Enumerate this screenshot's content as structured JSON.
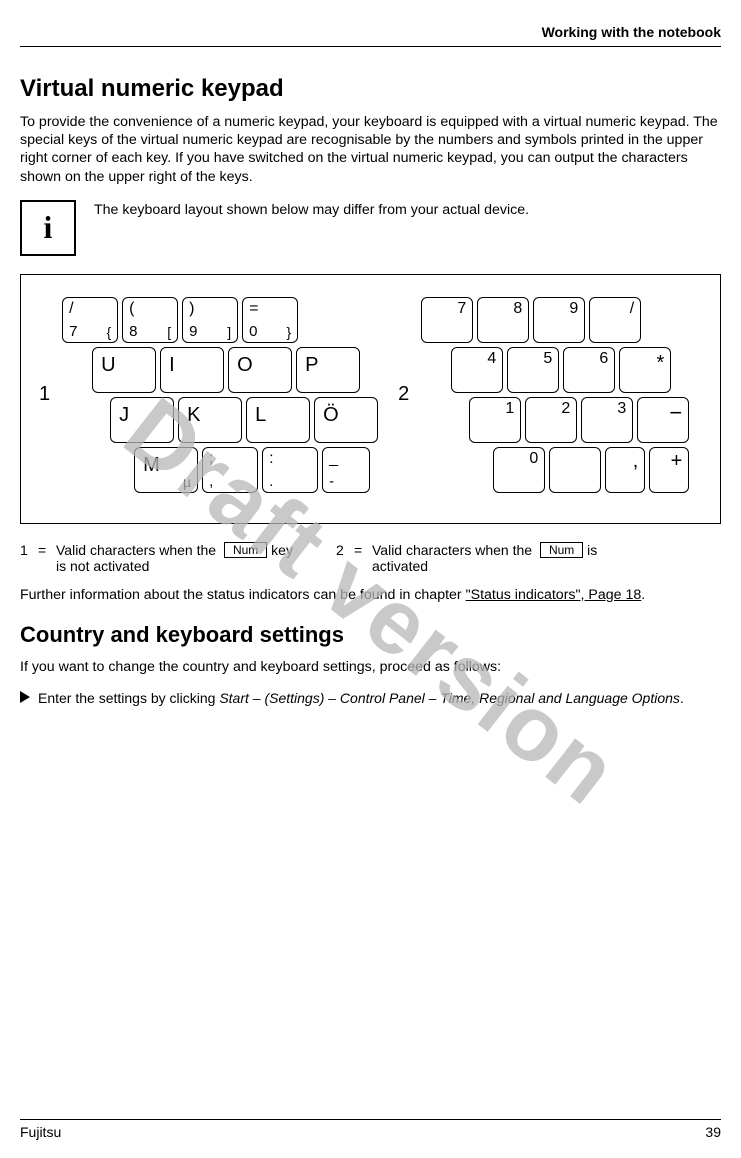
{
  "running_head": "Working with the notebook",
  "h_virtual": "Virtual numeric keypad",
  "p_intro": "To provide the convenience of a numeric keypad, your keyboard is equipped with a virtual numeric keypad. The special keys of the virtual numeric keypad are recognisable by the numbers and symbols printed in the upper right corner of each key. If you have switched on the virtual numeric keypad, you can output the characters shown on the upper right of the keys.",
  "note_glyph": "i",
  "note_text": "The keyboard layout shown below may differ from your actual device.",
  "diagram": {
    "label1": "1",
    "label2": "2",
    "left": {
      "row1": [
        {
          "tl": "/",
          "bl": "7",
          "br": "{"
        },
        {
          "tl": "(",
          "bl": "8",
          "br": "["
        },
        {
          "tl": ")",
          "bl": "9",
          "br": "]"
        },
        {
          "tl": "=",
          "bl": "0",
          "br": "}"
        }
      ],
      "row2": [
        "U",
        "I",
        "O",
        "P"
      ],
      "row3": [
        "J",
        "K",
        "L",
        "Ö"
      ],
      "row4": [
        {
          "big": "M",
          "br": "µ"
        },
        {
          "tl": ";",
          "bl": ","
        },
        {
          "tl": ":",
          "bl": "."
        },
        {
          "tl": "_",
          "bl": "-"
        }
      ]
    },
    "right": {
      "row1": [
        "7",
        "8",
        "9",
        "/"
      ],
      "row2": [
        "4",
        "5",
        "6",
        "*"
      ],
      "row3": [
        "1",
        "2",
        "3",
        "−"
      ],
      "row4": [
        "0",
        "",
        ",",
        "+"
      ]
    }
  },
  "legend": {
    "item1_num": "1",
    "item1_eq": "=",
    "item1_text_a": "Valid characters when the ",
    "item1_text_b": " key is not activated",
    "item2_num": "2",
    "item2_eq": "=",
    "item2_text_a": "Valid characters when the ",
    "item2_text_b": " is activated",
    "numkey": "Num"
  },
  "p_further_a": "Further information about the status indicators can be found in chapter ",
  "p_further_link": "\"Status indicators\", Page 18",
  "p_further_b": ".",
  "h_country": "Country and keyboard settings",
  "p_country": "If you want to change the country and keyboard settings, proceed as follows:",
  "step_a": "Enter the settings by clicking ",
  "step_path": "Start – (Settings) – Control Panel – Time, Regional and Language Options",
  "step_b": ".",
  "watermark": "Draft version",
  "footer_left": "Fujitsu",
  "footer_right": "39"
}
